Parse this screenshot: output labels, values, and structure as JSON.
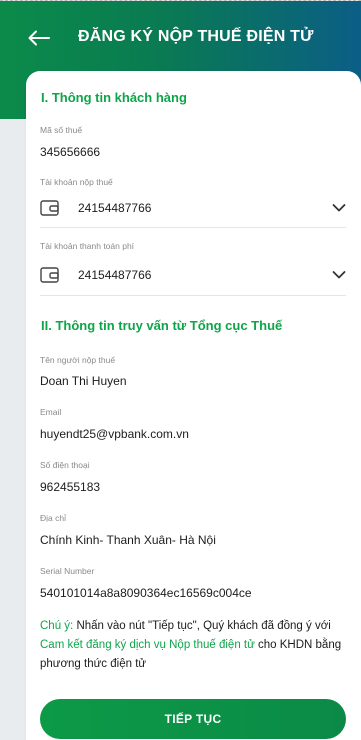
{
  "header": {
    "title": "ĐĂNG KÝ NỘP THUẾ ĐIỆN TỬ"
  },
  "section1": {
    "title": "I. Thông tin khách hàng",
    "tax_code_label": "Mã số thuế",
    "tax_code_value": "345656666",
    "tax_account_label": "Tài khoản nộp thuế",
    "tax_account_value": "24154487766",
    "fee_account_label": "Tài khoản thanh toán phí",
    "fee_account_value": "24154487766"
  },
  "section2": {
    "title": "II. Thông tin truy vấn từ Tổng cục Thuế",
    "payer_name_label": "Tên người nộp thuế",
    "payer_name_value": "Doan Thi Huyen",
    "email_label": "Email",
    "email_value": "huyendt25@vpbank.com.vn",
    "phone_label": "Số điện thoại",
    "phone_value": "962455183",
    "address_label": "Địa chỉ",
    "address_value": "Chính Kinh- Thanh Xuân- Hà Nội",
    "serial_label": "Serial Number",
    "serial_value": "540101014a8a8090364ec16569c004ce"
  },
  "note": {
    "prefix": "Chú ý:",
    "text1": " Nhấn vào nút \"Tiếp tục\", Quý khách đã đồng ý với ",
    "link": "Cam kết đăng ký dịch vụ Nộp thuế điện tử",
    "text2": " cho KHDN bằng phương thức điện tử"
  },
  "cta": {
    "label": "TIẾP TỤC"
  },
  "colors": {
    "accent_green": "#0ea54a",
    "header_start": "#0b8b4a",
    "header_end": "#0b5e86"
  },
  "icons": {
    "back": "arrow-left-icon",
    "wallet": "wallet-icon",
    "dropdown": "chevron-down-icon"
  }
}
